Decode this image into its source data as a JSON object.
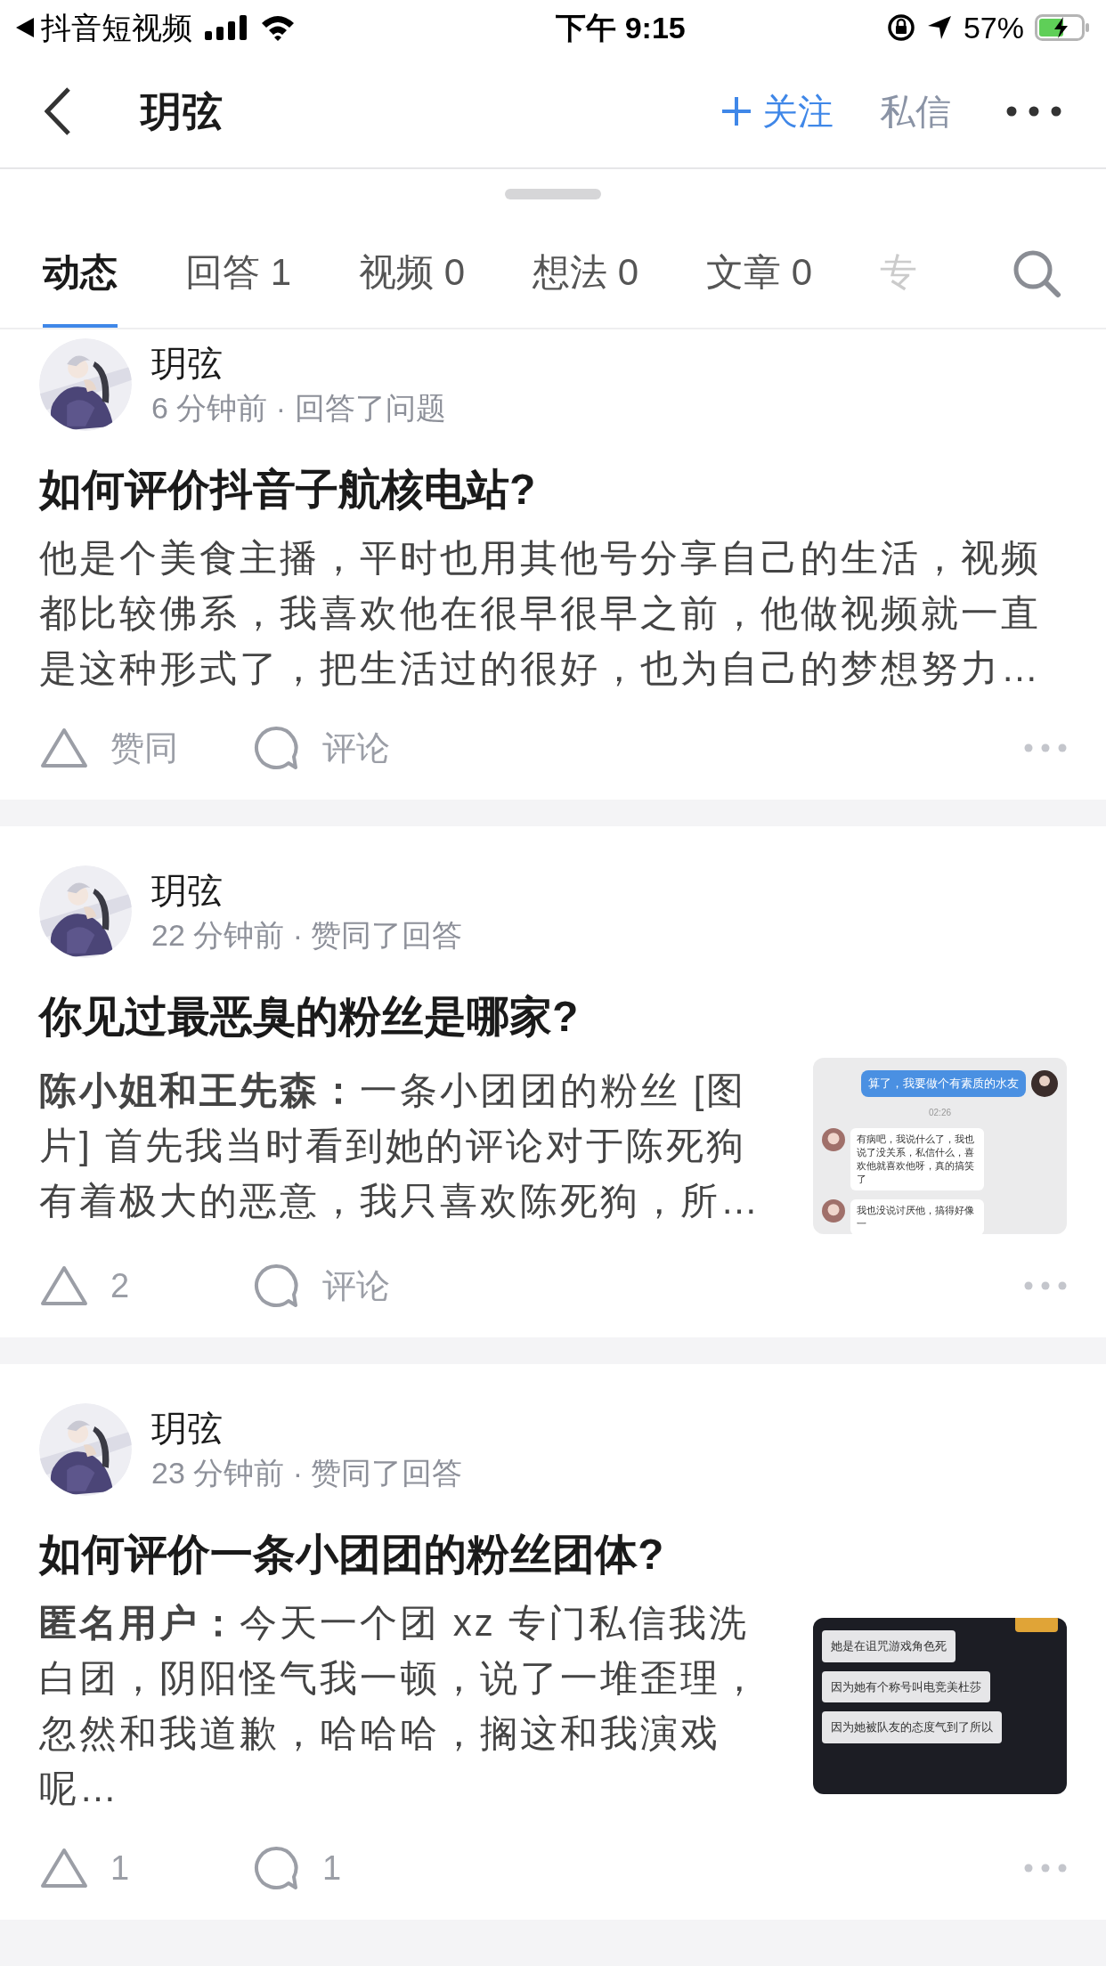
{
  "status_bar": {
    "return_app": "抖音短视频",
    "time": "下午 9:15",
    "battery": "57%"
  },
  "header": {
    "title": "玥弦",
    "follow": "关注",
    "message": "私信"
  },
  "tabs": [
    {
      "label": "动态",
      "selected": true
    },
    {
      "label": "回答 1",
      "selected": false
    },
    {
      "label": "视频 0",
      "selected": false
    },
    {
      "label": "想法 0",
      "selected": false
    },
    {
      "label": "文章 0",
      "selected": false
    },
    {
      "label": "专",
      "selected": false
    }
  ],
  "feed": [
    {
      "author": "玥弦",
      "meta": "6 分钟前 · 回答了问题",
      "title": "如何评价抖音子航核电站?",
      "excerpt": "他是个美食主播，平时也用其他号分享自己的生活，视频都比较佛系，我喜欢他在很早很早之前，他做视频就一直是这种形式了，把生活过的很好，也为自己的梦想努力…",
      "like": "赞同",
      "comment": "评论"
    },
    {
      "author": "玥弦",
      "meta": "22 分钟前 · 赞同了回答",
      "title": "你见过最恶臭的粉丝是哪家?",
      "excerpt": "**陈小姐和王先森：**一条小团团的粉丝 [图片] 首先我当时看到她的评论对于陈死狗有着极大的恶意，我只喜欢陈死狗，所…",
      "like": "2",
      "comment": "评论",
      "thumbnail": {
        "kind": "light",
        "items": [
          {
            "kind": "sent",
            "text": "算了，我要做个有素质的水友"
          },
          {
            "kind": "time",
            "text": "02:26"
          },
          {
            "kind": "received",
            "text": "有病吧，我说什么了，我也说了没关系，私信什么，喜欢他就喜欢他呀，真的搞笑了"
          },
          {
            "kind": "received",
            "text": "我也没说讨厌他，搞得好像一"
          }
        ]
      }
    },
    {
      "author": "玥弦",
      "meta": "23 分钟前 · 赞同了回答",
      "title": "如何评价一条小团团的粉丝团体?",
      "excerpt": "**匿名用户：**今天一个团 xz 专门私信我洗白团，阴阳怪气我一顿，说了一堆歪理，忽然和我道歉，哈哈哈，搁这和我演戏呢…",
      "like": "1",
      "comment": "1",
      "thumbnail": {
        "kind": "dark",
        "items": [
          {
            "kind": "bubble",
            "text": "她是在诅咒游戏角色死"
          },
          {
            "kind": "bubble",
            "text": "因为她有个称号叫电竞美杜莎"
          },
          {
            "kind": "bubble",
            "text": "因为她被队友的态度气到了所以"
          }
        ]
      }
    }
  ]
}
